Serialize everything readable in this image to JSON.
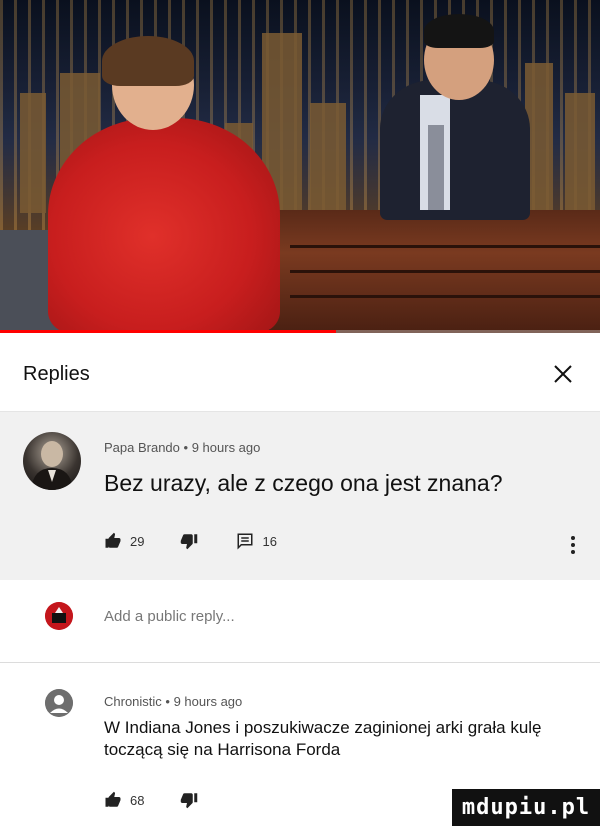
{
  "video": {
    "progress_fraction": 0.56
  },
  "header": {
    "title": "Replies"
  },
  "parent_comment": {
    "author": "Papa Brando",
    "time": "9 hours ago",
    "text": "Bez urazy, ale z czego ona jest znana?",
    "likes": "29",
    "replies": "16"
  },
  "add_reply": {
    "placeholder": "Add a public reply..."
  },
  "reply": {
    "author": "Chronistic",
    "time": "9 hours ago",
    "text": "W Indiana Jones i poszukiwacze zaginionej arki grała kulę toczącą się na Harrisona Forda",
    "likes": "68"
  },
  "watermark": "mdupiu.pl",
  "colors": {
    "progress": "#ff0000",
    "parent_bg": "#f1f1f1",
    "meta_text": "#555555"
  },
  "icons": [
    "close-icon",
    "thumb-up-icon",
    "thumb-down-icon",
    "comment-icon",
    "more-vert-icon",
    "person-icon"
  ]
}
